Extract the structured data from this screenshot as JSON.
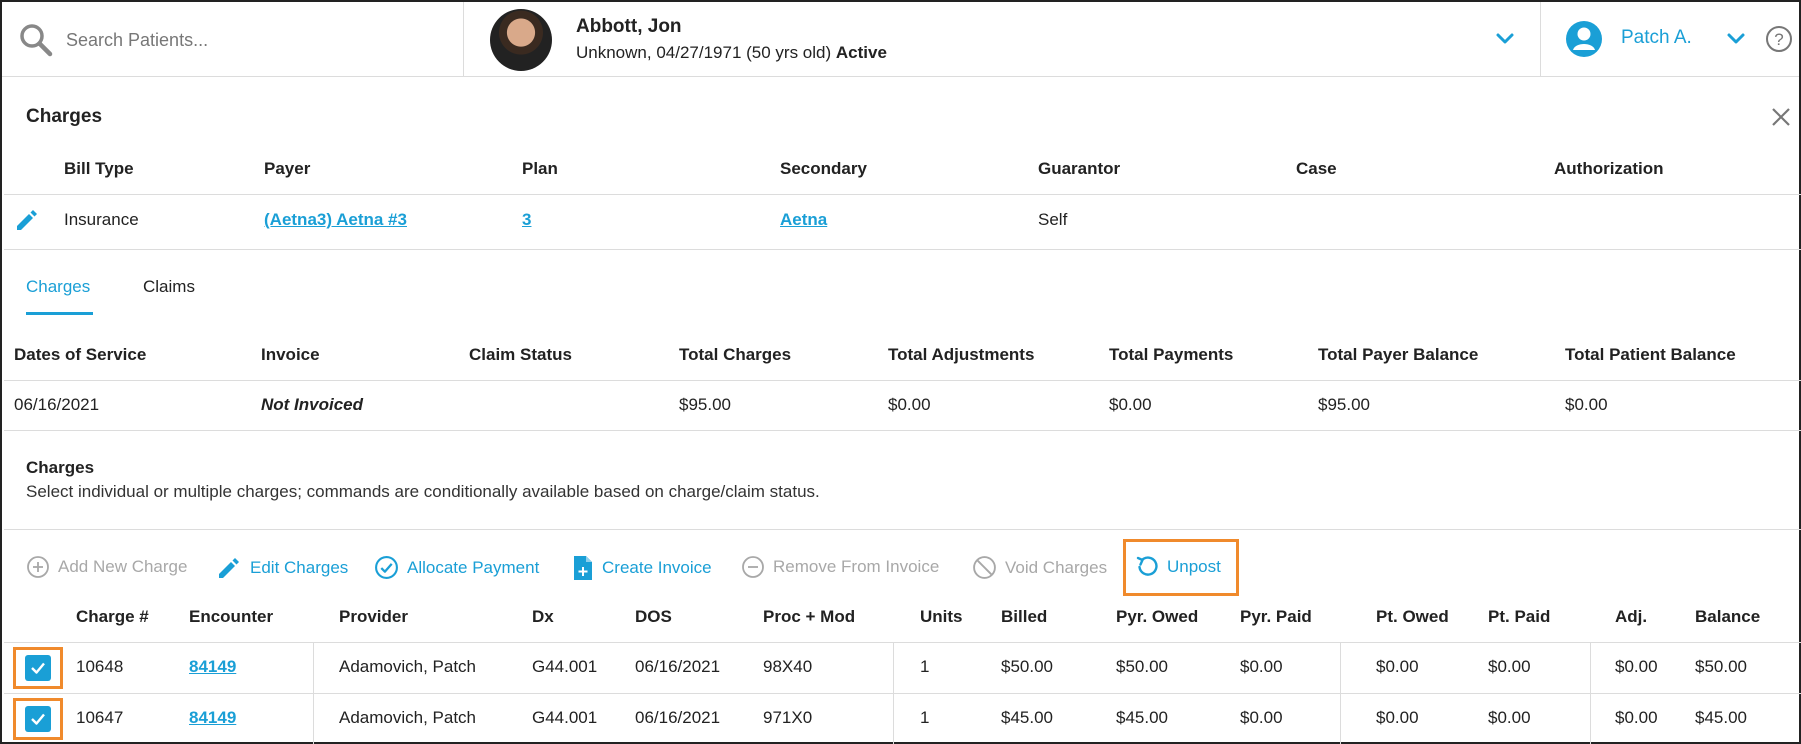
{
  "search": {
    "placeholder": "Search Patients..."
  },
  "patient": {
    "name": "Abbott, Jon",
    "info": "Unknown, 04/27/1971 (50 yrs old)",
    "status": "Active"
  },
  "user": {
    "name": "Patch A."
  },
  "charges_panel": {
    "title": "Charges",
    "bill_headers": [
      "Bill Type",
      "Payer",
      "Plan",
      "Secondary",
      "Guarantor",
      "Case",
      "Authorization"
    ],
    "bill_values": {
      "bill_type": "Insurance",
      "payer": "(Aetna3) Aetna #3",
      "plan": "3",
      "secondary": "Aetna",
      "guarantor": "Self",
      "case": "",
      "authorization": ""
    }
  },
  "tabs": [
    {
      "label": "Charges",
      "active": true
    },
    {
      "label": "Claims",
      "active": false
    }
  ],
  "summary": {
    "headers": [
      "Dates of Service",
      "Invoice",
      "Claim Status",
      "Total Charges",
      "Total Adjustments",
      "Total Payments",
      "Total Payer Balance",
      "Total Patient Balance"
    ],
    "values": [
      "06/16/2021",
      "Not Invoiced",
      "",
      "$95.00",
      "$0.00",
      "$0.00",
      "$95.00",
      "$0.00"
    ]
  },
  "charges_section": {
    "title": "Charges",
    "description": "Select individual or multiple charges; commands are conditionally available based on charge/claim status."
  },
  "toolbar": {
    "add_new_charge": "Add New Charge",
    "edit_charges": "Edit Charges",
    "allocate_payment": "Allocate Payment",
    "create_invoice": "Create Invoice",
    "remove_from_invoice": "Remove From Invoice",
    "void_charges": "Void Charges",
    "unpost": "Unpost"
  },
  "colors": {
    "accent": "#1a9fd6",
    "highlight": "#f08a2c",
    "disabled": "#a8a8a8"
  },
  "table": {
    "headers": [
      "Charge #",
      "Encounter",
      "Provider",
      "Dx",
      "DOS",
      "Proc + Mod",
      "Units",
      "Billed",
      "Pyr. Owed",
      "Pyr. Paid",
      "Pt. Owed",
      "Pt. Paid",
      "Adj.",
      "Balance"
    ],
    "rows": [
      {
        "checked": true,
        "cells": [
          "10648",
          "84149",
          "Adamovich, Patch",
          "G44.001",
          "06/16/2021",
          "98X40",
          "1",
          "$50.00",
          "$50.00",
          "$0.00",
          "$0.00",
          "$0.00",
          "$0.00",
          "$50.00"
        ]
      },
      {
        "checked": true,
        "cells": [
          "10647",
          "84149",
          "Adamovich, Patch",
          "G44.001",
          "06/16/2021",
          "971X0",
          "1",
          "$45.00",
          "$45.00",
          "$0.00",
          "$0.00",
          "$0.00",
          "$0.00",
          "$45.00"
        ]
      }
    ]
  }
}
